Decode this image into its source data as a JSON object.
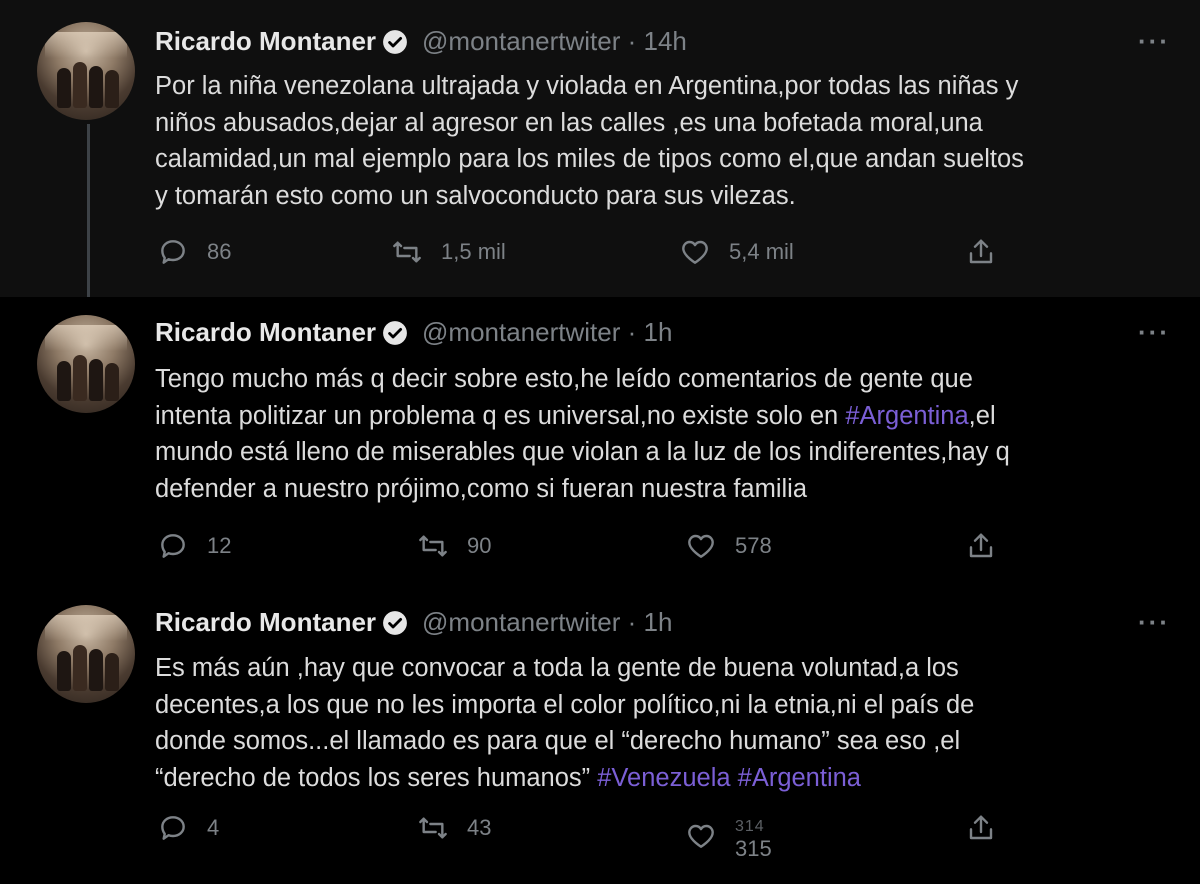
{
  "tweets": [
    {
      "name": "Ricardo Montaner",
      "handle": "@montanertwiter · 14h",
      "text": "Por la niña venezolana ultrajada y violada en Argentina,por todas las niñas y\nniños abusados,dejar al agresor en las calles ,es una bofetada moral,una\ncalamidad,un mal ejemplo para los miles de tipos como el,que andan sueltos\ny tomarán esto como un salvoconducto para sus vilezas.",
      "replies": "86",
      "retweets": "1,5 mil",
      "likes": "5,4 mil"
    },
    {
      "name": "Ricardo Montaner",
      "handle": "@montanertwiter · 1h",
      "text_before": "Tengo mucho más q decir sobre esto,he leído comentarios de gente que\nintenta politizar un problema q es universal,no existe solo en ",
      "hashtag": "#Argentina",
      "text_after": ",el\nmundo está lleno de miserables que violan a la luz de los indiferentes,hay q\ndefender a nuestro prójimo,como si fueran nuestra familia",
      "replies": "12",
      "retweets": "90",
      "likes": "578"
    },
    {
      "name": "Ricardo Montaner",
      "handle": "@montanertwiter · 1h",
      "text_before": "Es más aún ,hay que convocar a toda la gente de buena voluntad,a los\ndecentes,a los que no les importa el color político,ni la etnia,ni el país de\ndonde somos...el llamado es para que el “derecho humano” sea eso ,el\n“derecho de todos los seres humanos” ",
      "hashtag1": "#Venezuela",
      "hashtag2": "#Argentina",
      "replies": "4",
      "retweets": "43",
      "likes_prev": "314",
      "likes": "315"
    }
  ],
  "colors": {
    "background": "#000000",
    "hashtag": "#7b5fd6",
    "muted": "#7d8287",
    "text": "#dcdcdc"
  },
  "icons": [
    "verified-badge-icon",
    "more-icon",
    "reply-icon",
    "retweet-icon",
    "like-icon",
    "share-icon"
  ]
}
